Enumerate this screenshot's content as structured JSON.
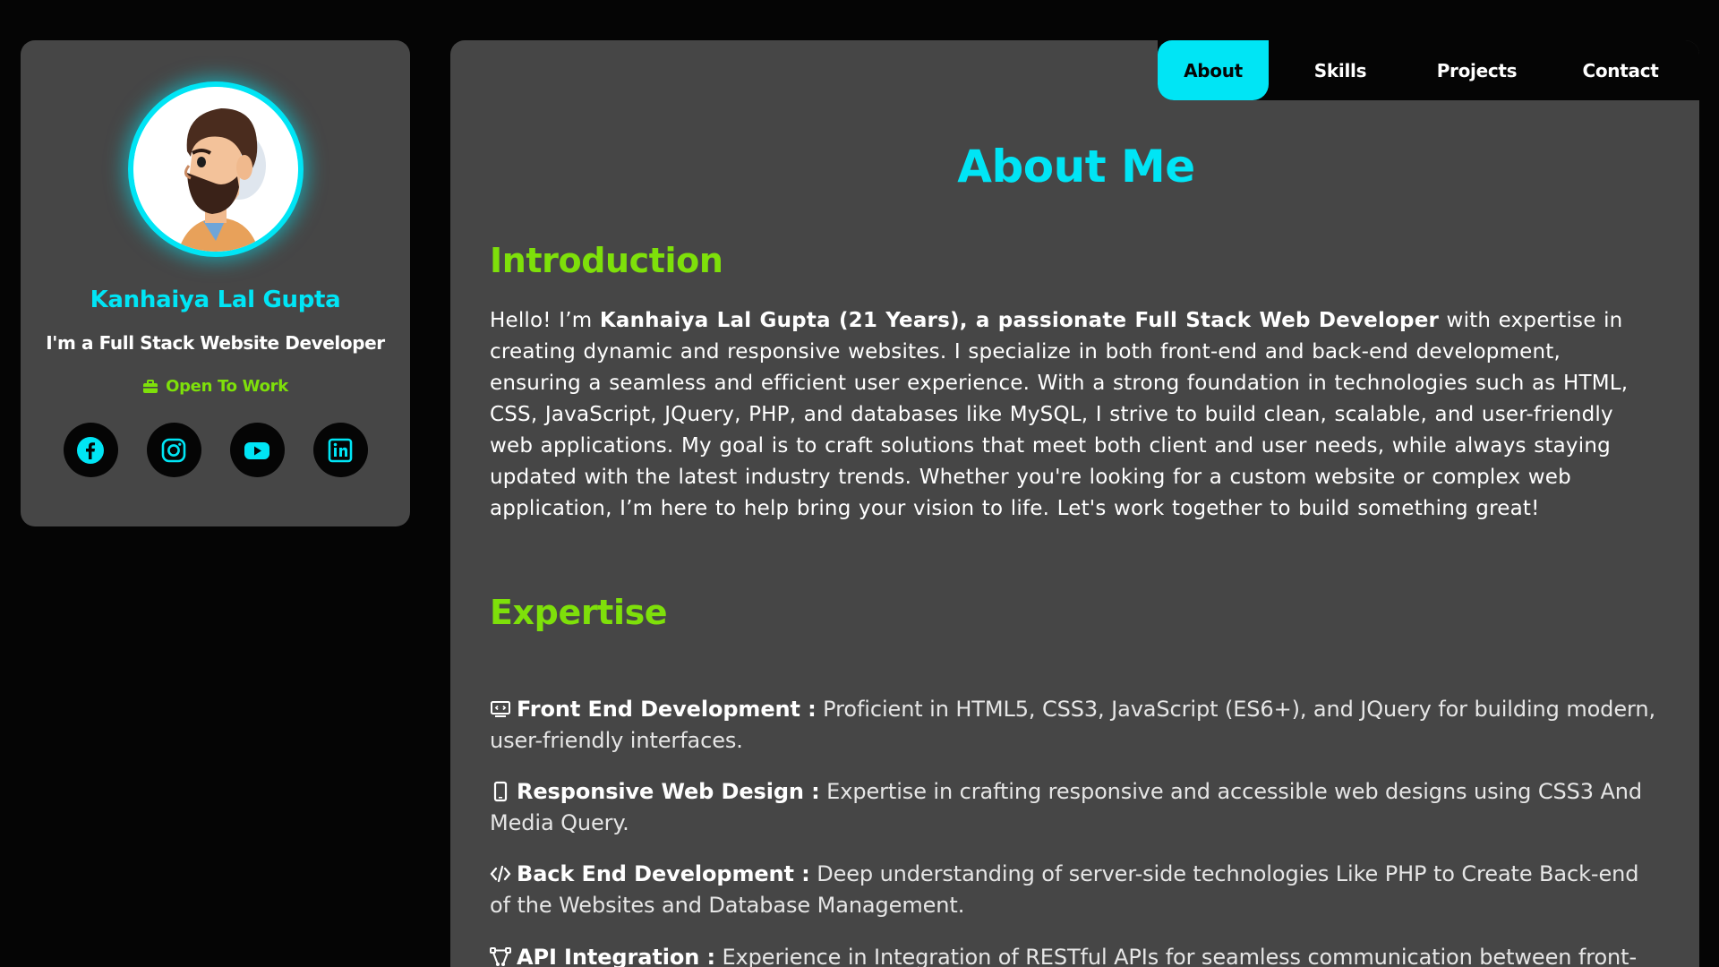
{
  "profile": {
    "name": "Kanhaiya Lal Gupta",
    "role": "I'm a Full Stack Website Developer",
    "status": "Open To Work",
    "status_icon": "briefcase-icon",
    "socials": [
      {
        "icon": "facebook-icon"
      },
      {
        "icon": "instagram-icon"
      },
      {
        "icon": "youtube-icon"
      },
      {
        "icon": "linkedin-icon"
      }
    ]
  },
  "nav": {
    "items": [
      {
        "label": "About",
        "active": true
      },
      {
        "label": "Skills",
        "active": false
      },
      {
        "label": "Projects",
        "active": false
      },
      {
        "label": "Contact",
        "active": false
      }
    ]
  },
  "about": {
    "title": "About Me",
    "intro_heading": "Introduction",
    "intro_prefix": "Hello! I’m ",
    "intro_bold": "Kanhaiya Lal Gupta (21 Years), a passionate Full Stack Web Developer",
    "intro_rest": " with expertise in creating dynamic and responsive websites. I specialize in both front-end and back-end development, ensuring a seamless and efficient user experience. With a strong foundation in technologies such as HTML, CSS, JavaScript, JQuery, PHP, and databases like MySQL, I strive to build clean, scalable, and user-friendly web applications. My goal is to craft solutions that meet both client and user needs, while always staying updated with the latest industry trends. Whether you're looking for a custom website or complex web application, I’m here to help bring your vision to life. Let's work together to build something great!",
    "expertise_heading": "Expertise",
    "expertise": [
      {
        "icon": "code-screen-icon",
        "title": "Front End Development :",
        "text": " Proficient in HTML5, CSS3, JavaScript (ES6+), and JQuery for building modern, user-friendly interfaces."
      },
      {
        "icon": "mobile-icon",
        "title": "Responsive Web Design :",
        "text": " Expertise in crafting responsive and accessible web designs using CSS3 And Media Query."
      },
      {
        "icon": "code-icon",
        "title": "Back End Development :",
        "text": " Deep understanding of server-side technologies Like PHP to Create Back-end of the Websites and Database Management."
      },
      {
        "icon": "api-icon",
        "title": "API Integration :",
        "text": " Experience in Integration of RESTful APIs for seamless communication between front-end and back-end systems."
      }
    ]
  },
  "colors": {
    "accent": "#00e5f5",
    "green": "#7ee00a",
    "panel": "#464646",
    "background": "#050505"
  }
}
